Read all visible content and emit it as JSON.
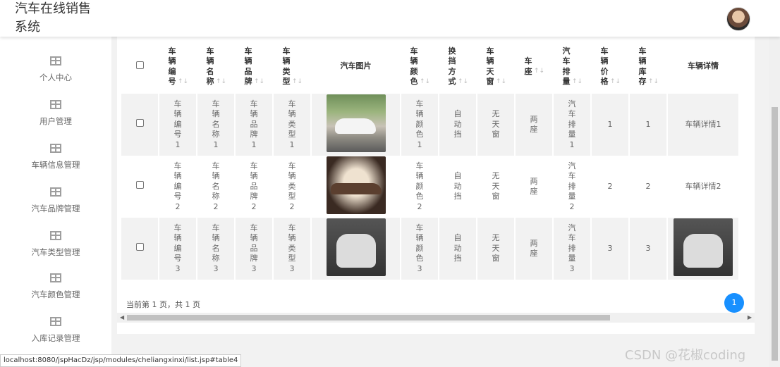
{
  "header": {
    "brand_line1": "汽车在线销售",
    "brand_line2": "系统"
  },
  "sidebar": {
    "items": [
      {
        "label": "个人中心"
      },
      {
        "label": "用户管理"
      },
      {
        "label": "车辆信息管理"
      },
      {
        "label": "汽车品牌管理"
      },
      {
        "label": "汽车类型管理"
      },
      {
        "label": "汽车颜色管理"
      },
      {
        "label": "入库记录管理"
      }
    ]
  },
  "table": {
    "columns": [
      {
        "label": "车辆编号",
        "sortable": true
      },
      {
        "label": "车辆名称",
        "sortable": true
      },
      {
        "label": "车辆品牌",
        "sortable": true
      },
      {
        "label": "车辆类型",
        "sortable": true
      },
      {
        "label": "汽车图片",
        "sortable": false
      },
      {
        "label": "车辆颜色",
        "sortable": true
      },
      {
        "label": "换挡方式",
        "sortable": true
      },
      {
        "label": "车辆天窗",
        "sortable": true
      },
      {
        "label": "车座",
        "sortable": true
      },
      {
        "label": "汽车排量",
        "sortable": true
      },
      {
        "label": "车辆价格",
        "sortable": true
      },
      {
        "label": "车辆库存",
        "sortable": true
      },
      {
        "label": "车辆详情",
        "sortable": false
      }
    ],
    "sort_glyph": "↑↓",
    "rows": [
      {
        "bh": "车辆编号1",
        "mc": "车辆名称1",
        "pp": "车辆品牌1",
        "lx": "车辆类型1",
        "ys": "车辆颜色1",
        "hd": "自动挡",
        "tc": "无天窗",
        "cz": "两座",
        "pl": "汽车排量1",
        "jg": "1",
        "kc": "1",
        "xq": "车辆详情1"
      },
      {
        "bh": "车辆编号2",
        "mc": "车辆名称2",
        "pp": "车辆品牌2",
        "lx": "车辆类型2",
        "ys": "车辆颜色2",
        "hd": "自动挡",
        "tc": "无天窗",
        "cz": "两座",
        "pl": "汽车排量2",
        "jg": "2",
        "kc": "2",
        "xq": "车辆详情2"
      },
      {
        "bh": "车辆编号3",
        "mc": "车辆名称3",
        "pp": "车辆品牌3",
        "lx": "车辆类型3",
        "ys": "车辆颜色3",
        "hd": "自动挡",
        "tc": "无天窗",
        "cz": "两座",
        "pl": "汽车排量3",
        "jg": "3",
        "kc": "3",
        "xq": ""
      }
    ]
  },
  "pagination": {
    "summary": "当前第 1 页，共 1 页",
    "current_page": "1"
  },
  "status_bar": "localhost:8080/jspHacDz/jsp/modules/cheliangxinxi/list.jsp#table4",
  "watermark": "CSDN @花椒coding",
  "colors": {
    "accent": "#1890ff"
  }
}
